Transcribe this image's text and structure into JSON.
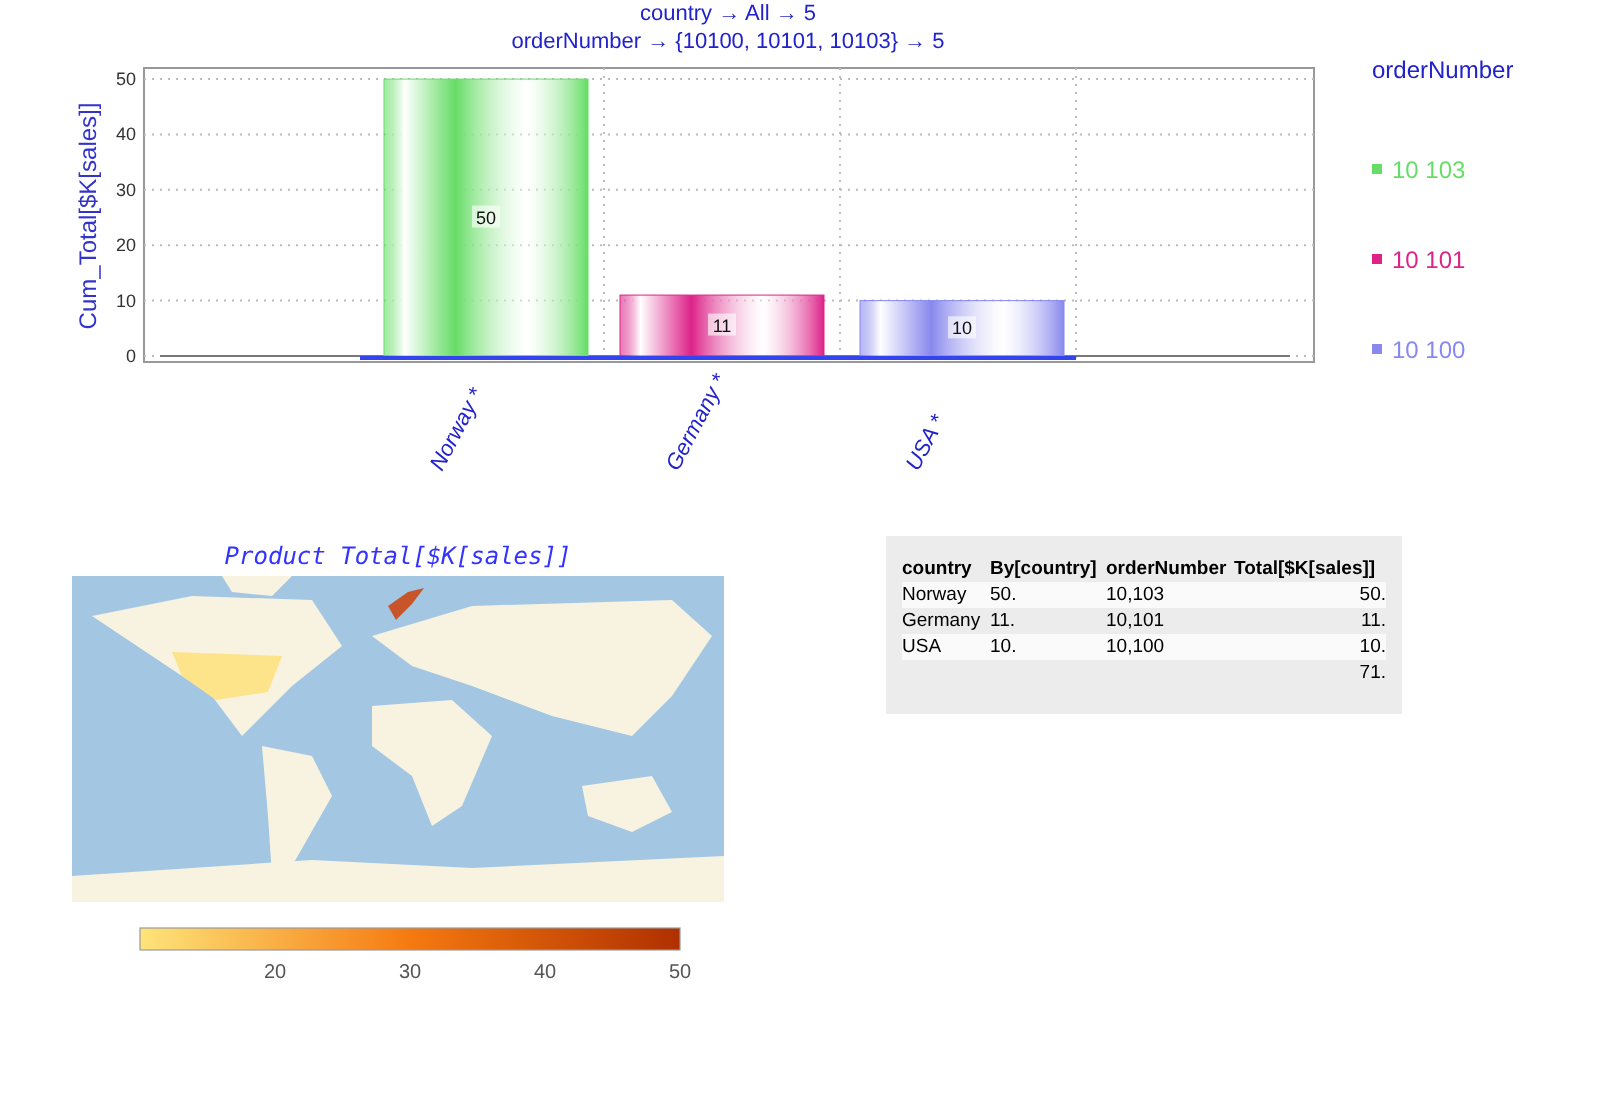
{
  "bar_chart": {
    "title_lines": [
      "country → All → 5",
      "orderNumber → {10100, 10101, 10103} → 5"
    ],
    "chart_data": {
      "type": "bar",
      "ylabel": "Cum_Total[$K[sales]]",
      "categories": [
        "Norway *",
        "Germany *",
        "USA *"
      ],
      "data_labels": true,
      "grid": true,
      "legend": "right",
      "ylim": [
        0,
        52
      ],
      "yticks": [
        0,
        10,
        20,
        30,
        40,
        50
      ],
      "series": [
        {
          "name": "10 103",
          "color": "#66dd66",
          "values": [
            50,
            null,
            null
          ]
        },
        {
          "name": "10 101",
          "color": "#dd2288",
          "values": [
            null,
            11,
            null
          ]
        },
        {
          "name": "10 100",
          "color": "#8888ee",
          "values": [
            null,
            null,
            10
          ]
        }
      ]
    },
    "legend_title": "orderNumber"
  },
  "map": {
    "title": "Product Total[$K[sales]]",
    "kind": "picture",
    "scale_ticks": [
      "20",
      "30",
      "40",
      "50"
    ]
  },
  "table": {
    "columns": [
      "country",
      "By[country]",
      "orderNumber",
      "Total[$K[sales]]"
    ],
    "rows": [
      [
        "Norway",
        "50.",
        "10,103",
        "50."
      ],
      [
        "Germany",
        "11.",
        "10,101",
        "11."
      ],
      [
        "USA",
        "10.",
        "10,100",
        "10."
      ],
      [
        "",
        "",
        "",
        "71."
      ]
    ]
  }
}
